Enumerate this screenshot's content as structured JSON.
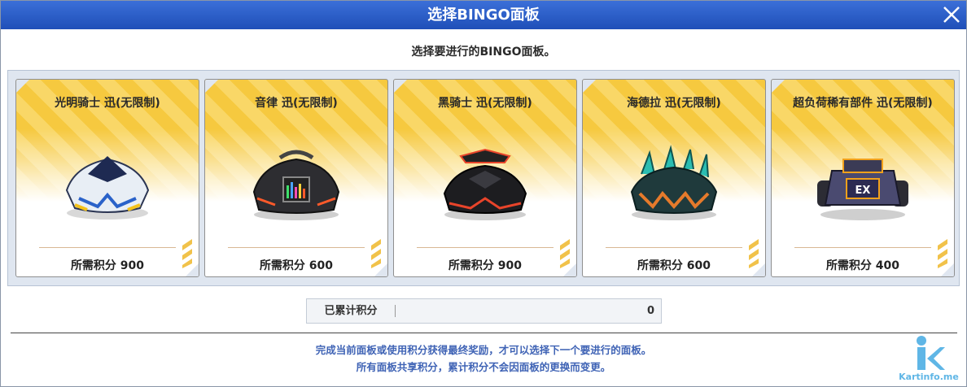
{
  "dialog": {
    "title": "选择BINGO面板",
    "subtitle": "选择要进行的BINGO面板。"
  },
  "cards": [
    {
      "name": "光明骑士 迅(无限制)",
      "cost": "所需积分 900",
      "car_icon": "car-white-blue-icon",
      "accent": "#ffcc33"
    },
    {
      "name": "音律 迅(无限制)",
      "cost": "所需积分 600",
      "car_icon": "car-black-speaker-icon",
      "accent": "#ff5a2a"
    },
    {
      "name": "黑骑士 迅(无限制)",
      "cost": "所需积分 900",
      "car_icon": "car-black-red-icon",
      "accent": "#e8442a"
    },
    {
      "name": "海德拉 迅(无限制)",
      "cost": "所需积分 600",
      "car_icon": "car-teal-hydra-icon",
      "accent": "#2bbdb1"
    },
    {
      "name": "超负荷稀有部件 迅(无限制)",
      "cost": "所需积分 400",
      "car_icon": "car-ex-buggy-icon",
      "accent": "#f2a11b"
    }
  ],
  "points": {
    "label": "已累计积分",
    "value": "0"
  },
  "notes": {
    "line1": "完成当前面板或使用积分获得最终奖励，才可以选择下一个要进行的面板。",
    "line2": "所有面板共享积分，累计积分不会因面板的更换而变更。"
  },
  "watermark": {
    "text": "Kartinfo.me"
  },
  "colors": {
    "title_bar": "#2a5cc9",
    "note_text": "#3f63b5",
    "card_gold": "#f6c93f"
  }
}
